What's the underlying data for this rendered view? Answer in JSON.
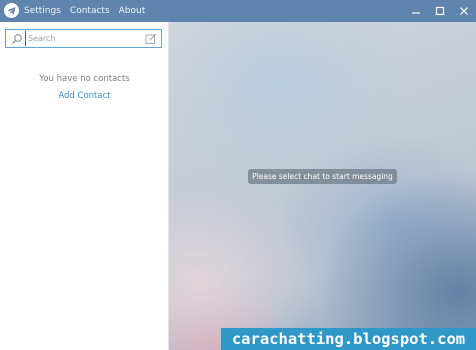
{
  "window": {
    "menu": [
      "Settings",
      "Contacts",
      "About"
    ],
    "controls": [
      "minimize-icon",
      "maximize-icon",
      "close-icon"
    ],
    "accent": "#5f84ad"
  },
  "sidebar": {
    "search": {
      "placeholder": "Search",
      "value": ""
    },
    "empty_message": "You have no contacts",
    "add_contact_label": "Add Contact"
  },
  "chat": {
    "placeholder_message": "Please select chat to start messaging"
  },
  "watermark": "carachatting.blogspot.com"
}
